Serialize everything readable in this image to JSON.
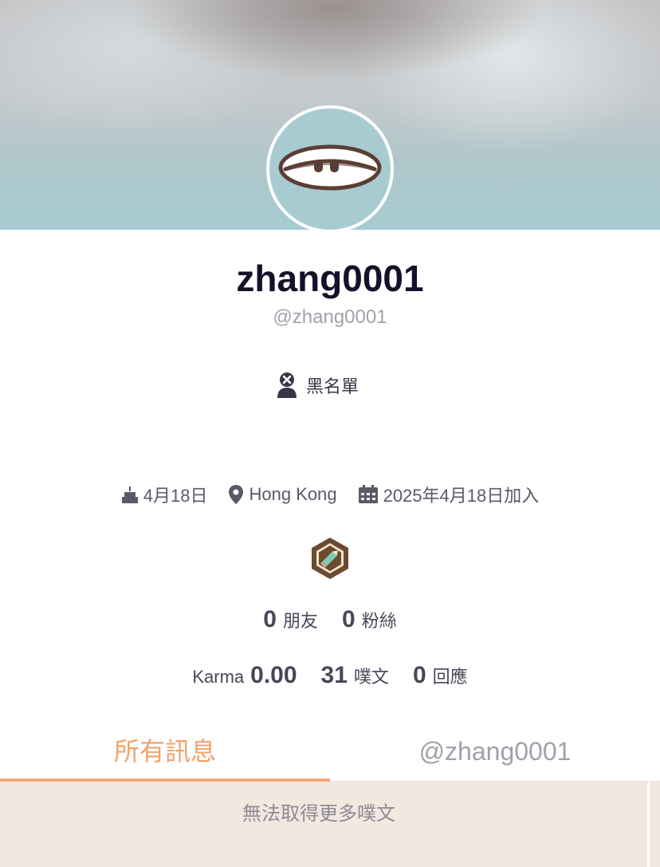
{
  "profile": {
    "display_name": "zhang0001",
    "handle": "@zhang0001",
    "blacklist_label": "黑名單"
  },
  "meta": {
    "birthday": "4月18日",
    "location": "Hong Kong",
    "joined": "2025年4月18日加入"
  },
  "stats": {
    "friends_count": "0",
    "friends_label": "朋友",
    "fans_count": "0",
    "fans_label": "粉絲",
    "karma_label": "Karma",
    "karma_value": "0.00",
    "plurks_count": "31",
    "plurks_label": "噗文",
    "replies_count": "0",
    "replies_label": "回應"
  },
  "tabs": [
    {
      "label": "所有訊息",
      "active": true
    },
    {
      "label": "@zhang0001",
      "active": false
    }
  ],
  "feed": {
    "message": "無法取得更多噗文"
  },
  "icons": {
    "blacklist": "user-blocked-icon",
    "birthday": "cake-icon",
    "location": "map-pin-icon",
    "joined": "calendar-icon",
    "badge": "pencil-badge-icon"
  },
  "colors": {
    "accent": "#f2a26a",
    "feed_bg": "#f2e8df",
    "text_muted": "#a3a0aa"
  }
}
